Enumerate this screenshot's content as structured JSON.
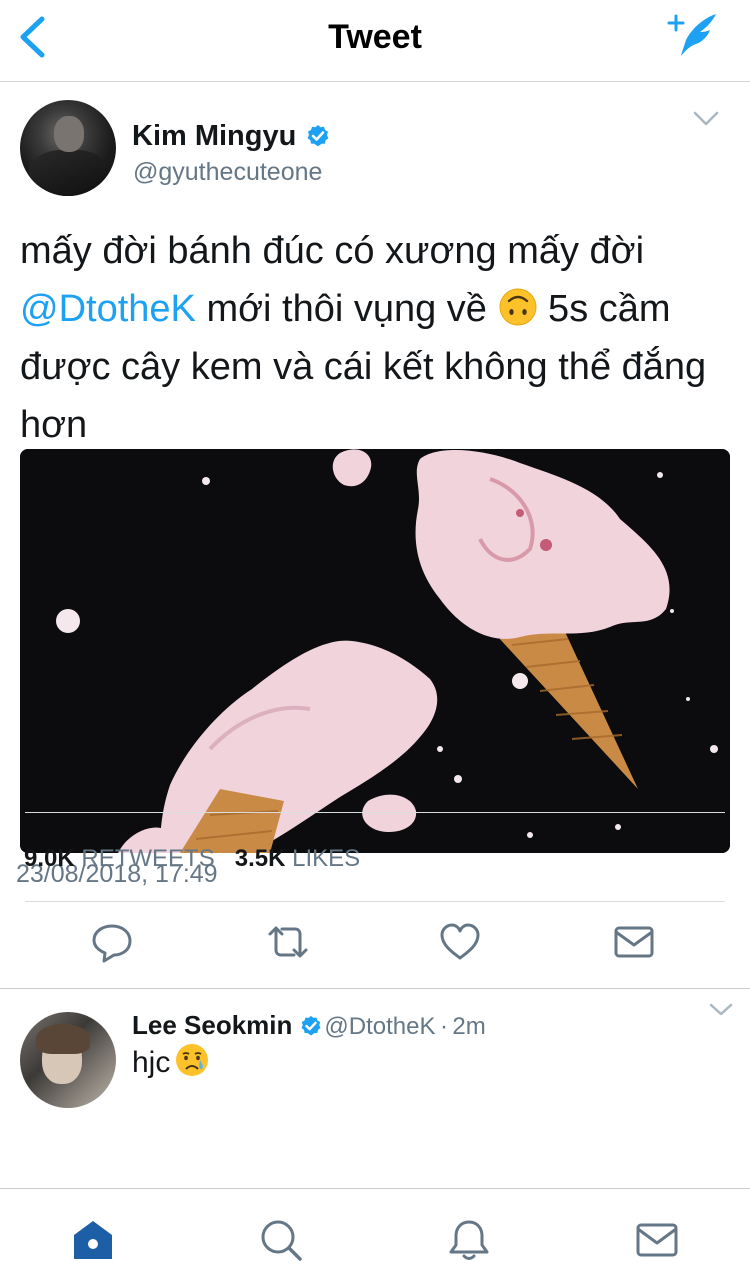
{
  "header": {
    "title": "Tweet",
    "back_icon": "chevron-left-icon",
    "compose_icon": "compose-tweet-icon"
  },
  "tweet": {
    "author_name": "Kim Mingyu",
    "author_handle": "@gyuthecuteone",
    "verified": true,
    "text_part1": "mấy đời bánh đúc có xương mấy đời ",
    "mention": "@DtotheK",
    "text_part2": " mới thôi vụng về ",
    "emoji": "upside-down-face",
    "text_part3": " 5s cầm được cây kem và cái kết không thể đắng hơn",
    "media_alt": "two melted pink ice cream cones on black background",
    "timestamp": "23/08/2018, 17:49",
    "stats": {
      "retweets_count": "9.0K",
      "retweets_label": "RETWEETS",
      "likes_count": "3.5K",
      "likes_label": "LIKES"
    },
    "actions": [
      "reply-icon",
      "retweet-icon",
      "like-icon",
      "direct-message-icon"
    ]
  },
  "reply": {
    "author_name": "Lee Seokmin",
    "author_handle": "@DtotheK",
    "separator": "·",
    "time": "2m",
    "text": "hjc",
    "emoji": "crying-face"
  },
  "tabbar": {
    "tabs": [
      "home-icon",
      "search-icon",
      "notifications-icon",
      "messages-icon"
    ],
    "active": "home-icon"
  },
  "colors": {
    "brand_blue": "#1da1f2",
    "text_primary": "#14171a",
    "text_secondary": "#657786",
    "divider": "#d9dde0"
  }
}
